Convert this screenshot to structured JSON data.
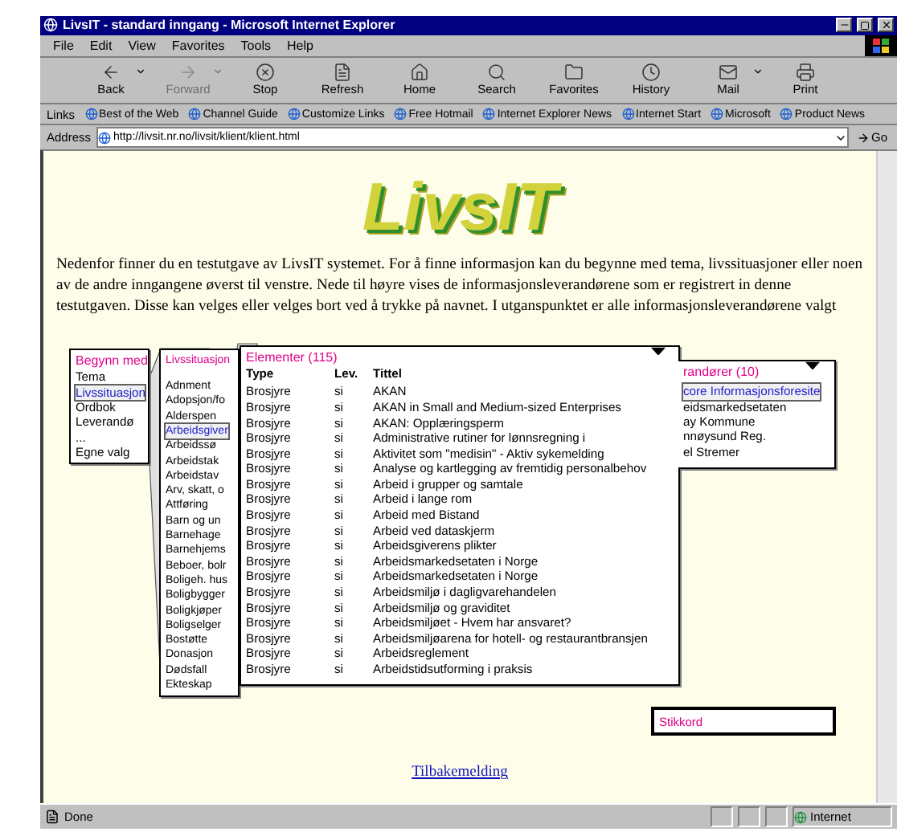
{
  "window": {
    "title": "LivsIT - standard inngang - Microsoft Internet Explorer"
  },
  "menu": [
    "File",
    "Edit",
    "View",
    "Favorites",
    "Tools",
    "Help"
  ],
  "toolbar": [
    {
      "label": "Back",
      "kind": "back",
      "disabled": false,
      "dropdown": true
    },
    {
      "label": "Forward",
      "kind": "forward",
      "disabled": true,
      "dropdown": true
    },
    {
      "label": "Stop",
      "kind": "stop",
      "disabled": false,
      "dropdown": false
    },
    {
      "label": "Refresh",
      "kind": "refresh",
      "disabled": false,
      "dropdown": false
    },
    {
      "label": "Home",
      "kind": "home",
      "disabled": false,
      "dropdown": false
    },
    {
      "label": "Search",
      "kind": "search",
      "disabled": false,
      "dropdown": false
    },
    {
      "label": "Favorites",
      "kind": "favorites",
      "disabled": false,
      "dropdown": false
    },
    {
      "label": "History",
      "kind": "history",
      "disabled": false,
      "dropdown": false
    },
    {
      "label": "Mail",
      "kind": "mail",
      "disabled": false,
      "dropdown": true
    },
    {
      "label": "Print",
      "kind": "print",
      "disabled": false,
      "dropdown": false
    }
  ],
  "links_bar": {
    "label": "Links",
    "items": [
      "Best of the Web",
      "Channel Guide",
      "Customize Links",
      "Free Hotmail",
      "Internet Explorer News",
      "Internet Start",
      "Microsoft",
      "Product News"
    ]
  },
  "address": {
    "label": "Address",
    "value": "http://livsit.nr.no/livsit/klient/klient.html",
    "go": "Go"
  },
  "page": {
    "logo": "LivsIT",
    "intro": "Nedenfor finner du en testutgave av LivsIT systemet. For å finne informasjon kan du begynne med tema, livssituasjoner eller noen av de andre inngangene øverst til venstre. Nede til høyre vises de informasjonsleverandørene som er registrert in denne testutgaven. Disse kan velges eller velges bort ved å trykke på navnet. I utganspunktet er alle informasjonsleverandørene valgt",
    "begin_panel": {
      "title": "Begynn med",
      "items": [
        {
          "label": "Tema",
          "selected": false
        },
        {
          "label": "Livssituasjon",
          "selected": true
        },
        {
          "label": "Ordbok",
          "selected": false
        },
        {
          "label": "Leverandø",
          "selected": false
        },
        {
          "label": "...",
          "selected": false
        },
        {
          "label": "Egne valg",
          "selected": false
        }
      ]
    },
    "situation_panel": {
      "title": "Livssituasjon",
      "items": [
        {
          "label": "Adnment",
          "selected": false
        },
        {
          "label": "Adopsjon/fo",
          "selected": false
        },
        {
          "label": "Alderspen",
          "selected": false
        },
        {
          "label": "Arbeidsgiver",
          "selected": true
        },
        {
          "label": "Arbeidssø",
          "selected": false
        },
        {
          "label": "Arbeidstak",
          "selected": false
        },
        {
          "label": "Arbeidstav",
          "selected": false
        },
        {
          "label": "Arv, skatt, o",
          "selected": false
        },
        {
          "label": "Attføring",
          "selected": false
        },
        {
          "label": "Barn og un",
          "selected": false
        },
        {
          "label": "Barnehage",
          "selected": false
        },
        {
          "label": "Barnehjems",
          "selected": false
        },
        {
          "label": "Beboer, bolr",
          "selected": false
        },
        {
          "label": "Boligeh. hus",
          "selected": false
        },
        {
          "label": "Boligbygger",
          "selected": false
        },
        {
          "label": "Boligkjøper",
          "selected": false
        },
        {
          "label": "Boligselger",
          "selected": false
        },
        {
          "label": "Bostøtte",
          "selected": false
        },
        {
          "label": "Donasjon",
          "selected": false
        },
        {
          "label": "Dødsfall",
          "selected": false
        },
        {
          "label": "Ekteskap",
          "selected": false
        }
      ]
    },
    "elements_panel": {
      "title": "Elementer (115)",
      "columns": [
        "Type",
        "Lev.",
        "Tittel"
      ],
      "rows": [
        [
          "Brosjyre",
          "si",
          "AKAN"
        ],
        [
          "Brosjyre",
          "si",
          "AKAN in Small and Medium-sized Enterprises"
        ],
        [
          "Brosjyre",
          "si",
          "AKAN: Opplæringsperm"
        ],
        [
          "Brosjyre",
          "si",
          "Administrative rutiner for lønnsregning i"
        ],
        [
          "Brosjyre",
          "si",
          "Aktivitet som \"medisin\" - Aktiv sykemelding"
        ],
        [
          "Brosjyre",
          "si",
          "Analyse og kartlegging av fremtidig personalbehov"
        ],
        [
          "Brosjyre",
          "si",
          "Arbeid i grupper og samtale"
        ],
        [
          "Brosjyre",
          "si",
          "Arbeid i lange rom"
        ],
        [
          "Brosjyre",
          "si",
          "Arbeid med Bistand"
        ],
        [
          "Brosjyre",
          "si",
          "Arbeid ved dataskjerm"
        ],
        [
          "Brosjyre",
          "si",
          "Arbeidsgiverens plikter"
        ],
        [
          "Brosjyre",
          "si",
          "Arbeidsmarkedsetaten i Norge"
        ],
        [
          "Brosjyre",
          "si",
          "Arbeidsmarkedsetaten i Norge"
        ],
        [
          "Brosjyre",
          "si",
          "Arbeidsmiljø i dagligvarehandelen"
        ],
        [
          "Brosjyre",
          "si",
          "Arbeidsmiljø og graviditet"
        ],
        [
          "Brosjyre",
          "si",
          "Arbeidsmiljøet - Hvem har ansvaret?"
        ],
        [
          "Brosjyre",
          "si",
          "Arbeidsmiljøarena for hotell- og restaurantbransjen"
        ],
        [
          "Brosjyre",
          "si",
          "Arbeidsreglement"
        ],
        [
          "Brosjyre",
          "si",
          "Arbeidstidsutforming i praksis"
        ]
      ]
    },
    "supplier_panel": {
      "title": "randører (10)",
      "items": [
        {
          "label": "core Informasjonsforesite",
          "selected": true
        },
        {
          "label": "eidsmarkedsetaten",
          "selected": false
        },
        {
          "label": "ay Kommune",
          "selected": false
        },
        {
          "label": "nnøysund Reg.",
          "selected": false
        },
        {
          "label": "el Stremer",
          "selected": false
        }
      ]
    },
    "keyword_field": {
      "placeholder": "Stikkord"
    },
    "feedback_link": "Tilbakemelding"
  },
  "status_bar": {
    "text": "Done",
    "zone": "Internet"
  }
}
